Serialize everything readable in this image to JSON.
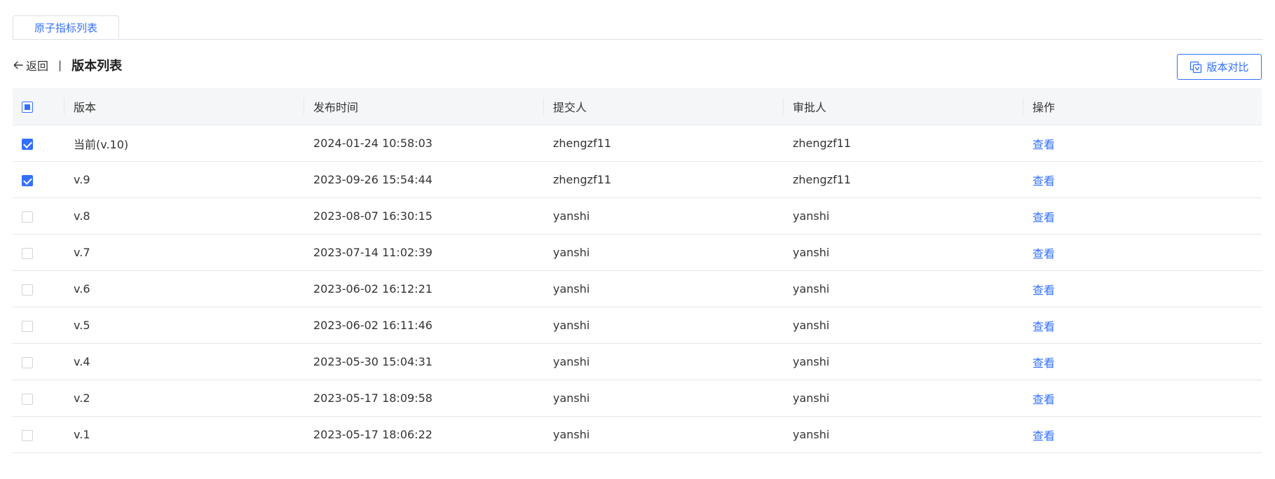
{
  "tabs": [
    {
      "label": "原子指标列表"
    }
  ],
  "header": {
    "back_label": "返回",
    "separator": "|",
    "title": "版本列表"
  },
  "toolbar": {
    "compare_label": "版本对比"
  },
  "table": {
    "columns": [
      "版本",
      "发布时间",
      "提交人",
      "审批人",
      "操作"
    ],
    "select_all_state": "partial",
    "rows": [
      {
        "checked": true,
        "version": "当前(v.10)",
        "time": "2024-01-24 10:58:03",
        "submitter": "zhengzf11",
        "approver": "zhengzf11",
        "action": "查看"
      },
      {
        "checked": true,
        "version": "v.9",
        "time": "2023-09-26 15:54:44",
        "submitter": "zhengzf11",
        "approver": "zhengzf11",
        "action": "查看"
      },
      {
        "checked": false,
        "version": "v.8",
        "time": "2023-08-07 16:30:15",
        "submitter": "yanshi",
        "approver": "yanshi",
        "action": "查看"
      },
      {
        "checked": false,
        "version": "v.7",
        "time": "2023-07-14 11:02:39",
        "submitter": "yanshi",
        "approver": "yanshi",
        "action": "查看"
      },
      {
        "checked": false,
        "version": "v.6",
        "time": "2023-06-02 16:12:21",
        "submitter": "yanshi",
        "approver": "yanshi",
        "action": "查看"
      },
      {
        "checked": false,
        "version": "v.5",
        "time": "2023-06-02 16:11:46",
        "submitter": "yanshi",
        "approver": "yanshi",
        "action": "查看"
      },
      {
        "checked": false,
        "version": "v.4",
        "time": "2023-05-30 15:04:31",
        "submitter": "yanshi",
        "approver": "yanshi",
        "action": "查看"
      },
      {
        "checked": false,
        "version": "v.2",
        "time": "2023-05-17 18:09:58",
        "submitter": "yanshi",
        "approver": "yanshi",
        "action": "查看"
      },
      {
        "checked": false,
        "version": "v.1",
        "time": "2023-05-17 18:06:22",
        "submitter": "yanshi",
        "approver": "yanshi",
        "action": "查看"
      }
    ]
  },
  "colors": {
    "accent": "#3370ff",
    "header_bg": "#f5f6f8",
    "border": "#e4e7ed"
  },
  "icons": {
    "back": "arrow-left-icon",
    "compare": "compare-icon"
  }
}
